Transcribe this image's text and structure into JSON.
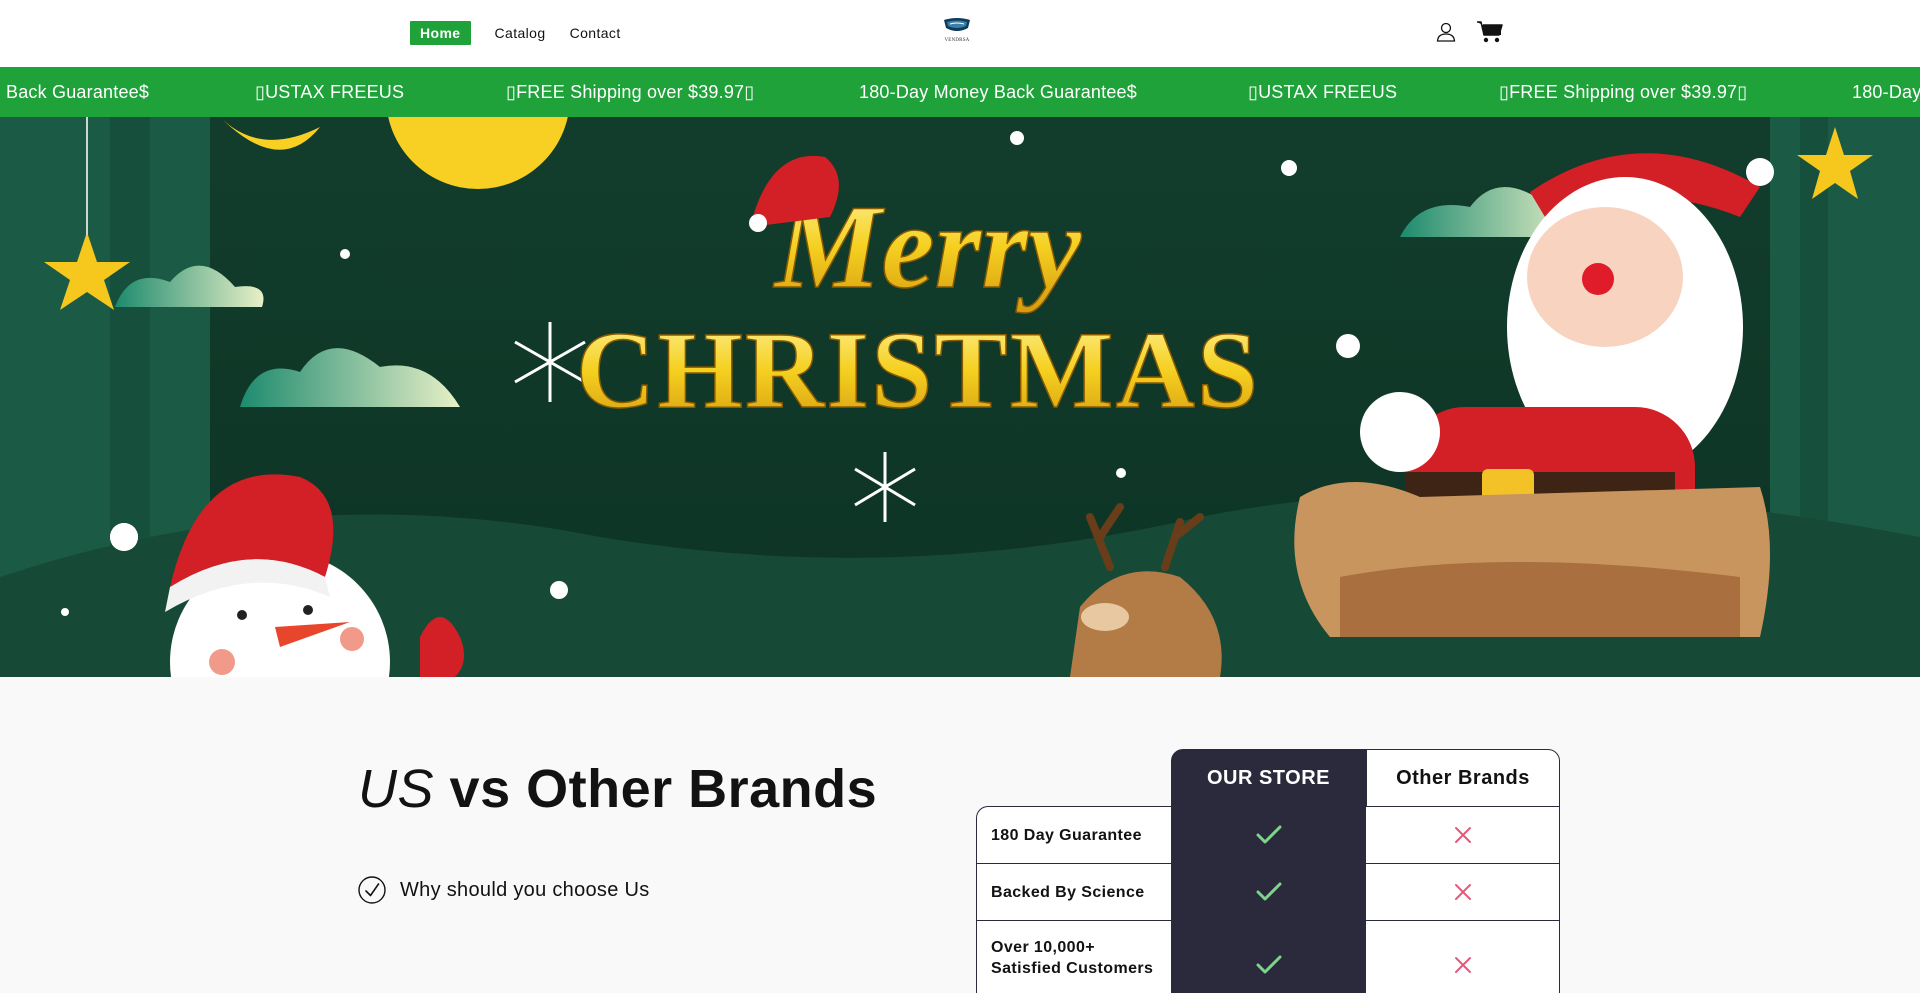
{
  "header": {
    "nav": [
      {
        "label": "Home",
        "active": true
      },
      {
        "label": "Catalog"
      },
      {
        "label": "Contact"
      }
    ],
    "logo_text": "VENDRSA",
    "icons": [
      "account-icon",
      "cart-icon"
    ]
  },
  "announcement": {
    "items": [
      "Back Guarantee$",
      "USTAX FREEUS",
      "FREE Shipping over $39.97",
      "180-Day Money Back Guarantee$",
      "USTAX FREEUS",
      "FREE Shipping over $39.97",
      "180-Day"
    ],
    "background": "#1fa23a"
  },
  "hero": {
    "heading_line1": "Merry",
    "heading_line2": "CHRISTMAS"
  },
  "comparison": {
    "title_us": "US",
    "title_rest": "vs Other Brands",
    "why_text": "Why should you choose Us",
    "col_ours": "OUR STORE",
    "col_other": "Other Brands",
    "rows": [
      {
        "label": "180 Day Guarantee",
        "ours": true,
        "other": false
      },
      {
        "label": "Backed By Science",
        "ours": true,
        "other": false
      },
      {
        "label": "Over 10,000+ Satisfied Customers",
        "ours": true,
        "other": false
      }
    ],
    "colors": {
      "dark": "#2b2a3d",
      "check": "#7dd58a",
      "cross": "#e35a7a"
    }
  }
}
